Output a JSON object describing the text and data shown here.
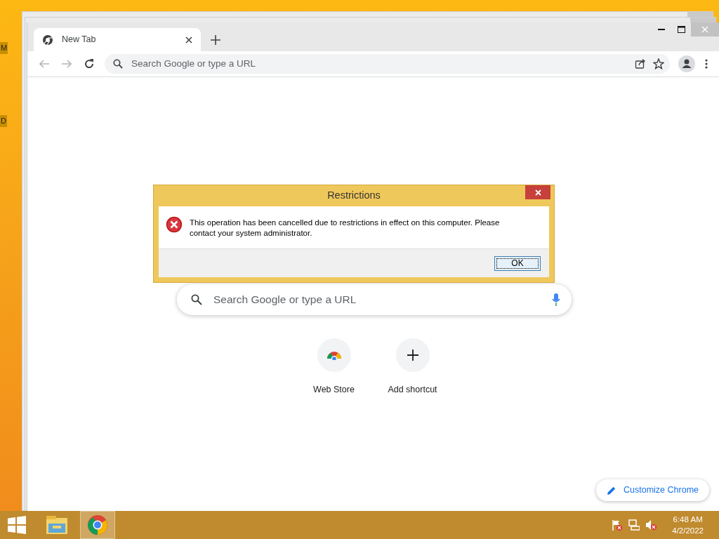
{
  "desktop_labels": [
    "M",
    "D"
  ],
  "browser": {
    "tabs": [
      {
        "label": "New Tab",
        "selected": true
      }
    ],
    "nav": {
      "back_disabled": true,
      "forward_disabled": true
    },
    "omnibox": {
      "placeholder": "Search Google or type a URL"
    },
    "page": {
      "search": {
        "placeholder": "Search Google or type a URL"
      },
      "shortcuts": [
        {
          "label": "Web Store",
          "kind": "store"
        },
        {
          "label": "Add shortcut",
          "kind": "add"
        }
      ],
      "customize_button": "Customize Chrome"
    }
  },
  "dialog": {
    "title": "Restrictions",
    "message": "This operation has been cancelled due to restrictions in effect on this computer. Please contact your system administrator.",
    "buttons": [
      {
        "label": "OK",
        "selected": true
      }
    ]
  },
  "taskbar": {
    "apps": [
      {
        "kind": "explorer",
        "active": false
      },
      {
        "kind": "chrome",
        "active": true
      }
    ],
    "time": "6:48 AM",
    "date": "4/2/2022"
  }
}
